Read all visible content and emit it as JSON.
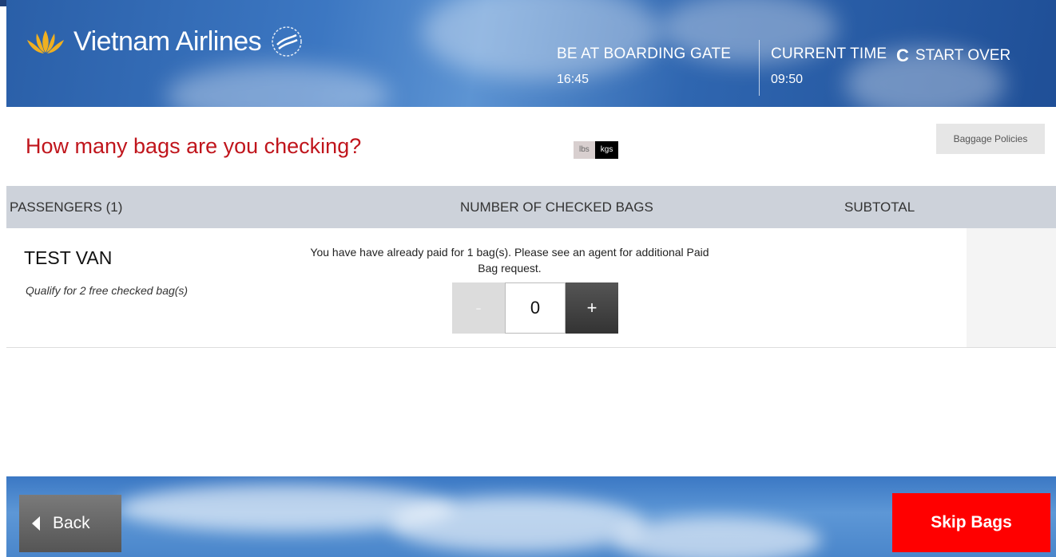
{
  "header": {
    "brand": "Vietnam Airlines",
    "boarding_label": "BE AT BOARDING GATE",
    "boarding_time": "16:45",
    "current_label": "CURRENT TIME",
    "current_time": "09:50",
    "start_over": "START OVER"
  },
  "page": {
    "title": "How many bags are you checking?",
    "unit_lbs": "lbs",
    "unit_kgs": "kgs",
    "selected_unit": "kgs",
    "policies_button": "Baggage Policies"
  },
  "table": {
    "col_passengers": "PASSENGERS (1)",
    "col_bags": "NUMBER OF CHECKED BAGS",
    "col_subtotal": "SUBTOTAL"
  },
  "passenger": {
    "name": "TEST VAN",
    "qualify": "Qualify for 2 free checked bag(s)",
    "message": "You have have already paid for 1 bag(s). Please see an agent for additional Paid Bag request.",
    "bag_count": "0",
    "minus": "-",
    "plus": "+"
  },
  "footer": {
    "back": "Back",
    "skip": "Skip Bags"
  },
  "colors": {
    "brand_blue": "#2a5fa8",
    "title_red": "#c0151c",
    "skip_red": "#ff0000",
    "gold": "#f0b020"
  }
}
